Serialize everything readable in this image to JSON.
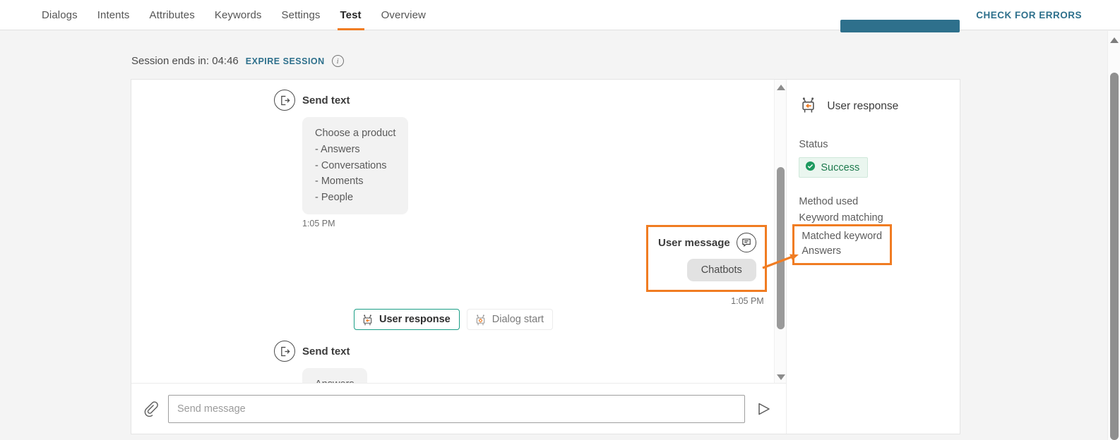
{
  "topnav": {
    "tabs": [
      {
        "label": "Dialogs",
        "active": false
      },
      {
        "label": "Intents",
        "active": false
      },
      {
        "label": "Attributes",
        "active": false
      },
      {
        "label": "Keywords",
        "active": false
      },
      {
        "label": "Settings",
        "active": false
      },
      {
        "label": "Test",
        "active": true
      },
      {
        "label": "Overview",
        "active": false
      }
    ],
    "check_errors_label": "CHECK FOR ERRORS",
    "accent_color": "#f07c22",
    "link_color": "#2e708c"
  },
  "session": {
    "text": "Session ends in: 04:46",
    "expire_label": "EXPIRE SESSION",
    "info_glyph": "i"
  },
  "chat": {
    "bot_message": {
      "title": "Send text",
      "body": "Choose a product\n- Answers\n- Conversations\n- Moments\n- People",
      "time": "1:05 PM"
    },
    "user_message": {
      "title": "User message",
      "body": "Chatbots",
      "time": "1:05 PM",
      "highlight_color": "#f07c22"
    },
    "chips": [
      {
        "label": "User response",
        "selected": true
      },
      {
        "label": "Dialog start",
        "selected": false
      }
    ],
    "bot_message_2": {
      "title": "Send text",
      "body": "Answers"
    }
  },
  "composer": {
    "placeholder": "Send message",
    "value": ""
  },
  "detail": {
    "title": "User response",
    "status_label": "Status",
    "status_value": "Success",
    "status_color": "#1d7a4d",
    "method_label": "Method used",
    "method_value": "Keyword matching",
    "matched_label": "Matched keyword",
    "matched_value": "Answers"
  }
}
